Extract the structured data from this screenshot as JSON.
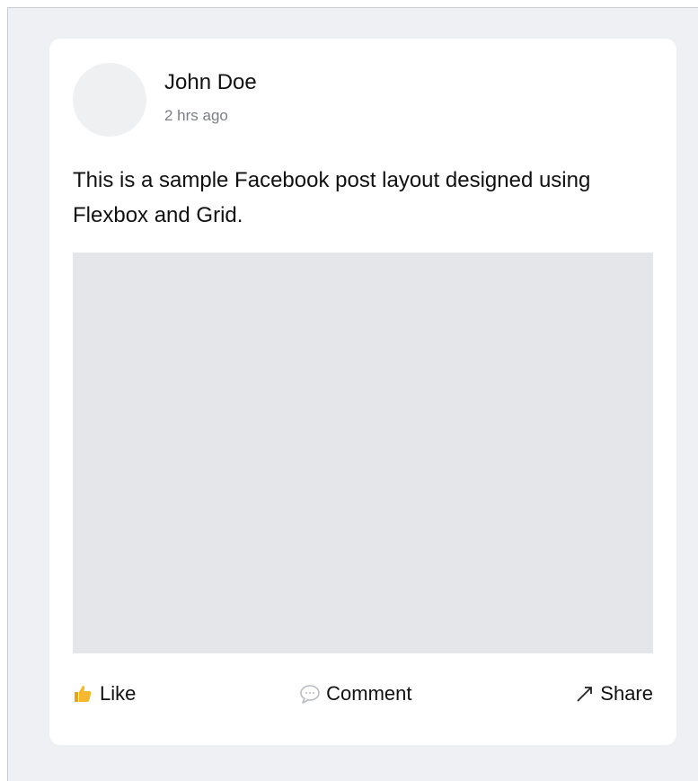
{
  "post": {
    "author_name": "John Doe",
    "timestamp": "2 hrs ago",
    "text": "This is a sample Facebook post layout designed using Flexbox and Grid.",
    "image_alt": "",
    "actions": [
      {
        "label": "Like",
        "icon": "thumbs-up-icon"
      },
      {
        "label": "Comment",
        "icon": "comment-icon"
      },
      {
        "label": "Share",
        "icon": "share-arrow-icon"
      }
    ]
  },
  "colors": {
    "page_background": "#eef0f3",
    "card_background": "#ffffff",
    "avatar_placeholder": "#eff0f2",
    "media_placeholder": "#e4e6e9",
    "like_icon": "#f5b82e",
    "muted_text": "#7b7f85"
  }
}
